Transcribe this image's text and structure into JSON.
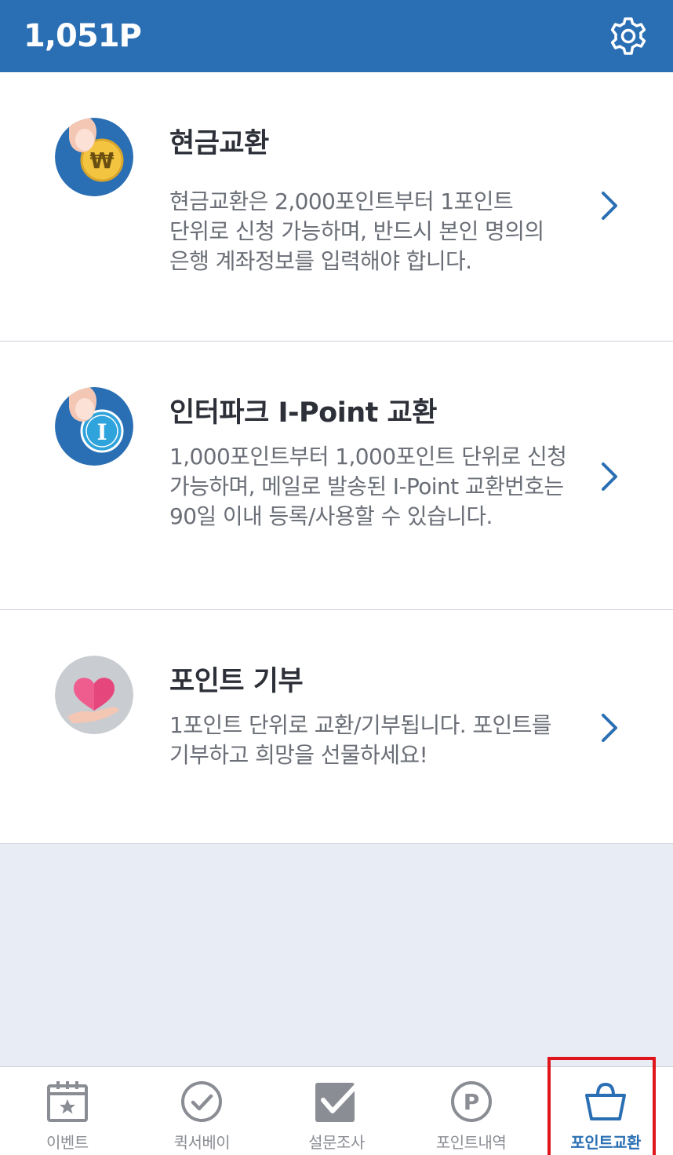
{
  "header": {
    "points": "1,051P",
    "settings_icon": "gear-icon",
    "bg_color": "#2a6fb3"
  },
  "cards": [
    {
      "title": "현금교환",
      "description": "현금교환은 2,000포인트부터 1포인트 단위로 신청 가능하며, 반드시 본인 명의의 은행 계좌정보를 입력해야 합니다.",
      "icon": "won-coin-icon"
    },
    {
      "title": "인터파크 I-Point 교환",
      "description": "1,000포인트부터 1,000포인트 단위로 신청 가능하며, 메일로 발송된 I-Point 교환번호는 90일 이내 등록/사용할 수 있습니다.",
      "icon": "ipoint-coin-icon"
    },
    {
      "title": "포인트 기부",
      "description": "1포인트 단위로 교환/기부됩니다. 포인트를 기부하고 희망을 선물하세요!",
      "icon": "heart-hand-icon"
    }
  ],
  "tabbar": {
    "items": [
      {
        "label": "이벤트",
        "icon": "calendar-star-icon"
      },
      {
        "label": "퀵서베이",
        "icon": "check-circle-icon"
      },
      {
        "label": "설문조사",
        "icon": "checkbox-icon"
      },
      {
        "label": "포인트내역",
        "icon": "p-coin-icon"
      },
      {
        "label": "포인트교환",
        "icon": "shopping-bag-icon"
      }
    ],
    "active_index": 4,
    "active_color": "#2a6fb3",
    "highlight_color": "#e0141b"
  }
}
